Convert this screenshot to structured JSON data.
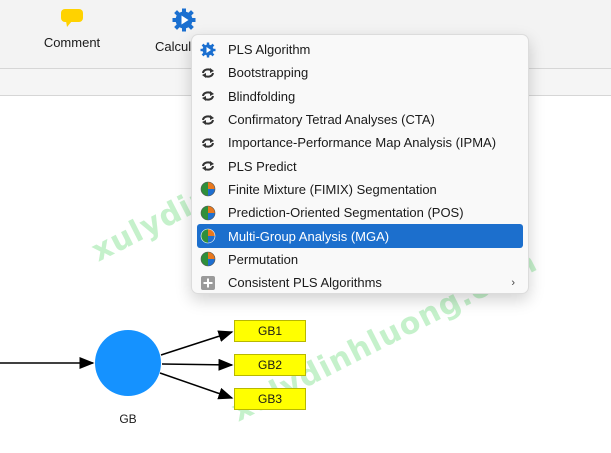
{
  "toolbar": {
    "comment_label": "Comment",
    "calculate_label": "Calcul"
  },
  "menu": {
    "items": [
      {
        "label": "PLS Algorithm",
        "icon": "gear-play-icon"
      },
      {
        "label": "Bootstrapping",
        "icon": "cycle-arrows-icon"
      },
      {
        "label": "Blindfolding",
        "icon": "cycle-arrows-icon"
      },
      {
        "label": "Confirmatory Tetrad Analyses (CTA)",
        "icon": "cycle-arrows-icon"
      },
      {
        "label": "Importance-Performance Map Analysis (IPMA)",
        "icon": "cycle-arrows-icon"
      },
      {
        "label": "PLS Predict",
        "icon": "cycle-arrows-icon"
      },
      {
        "label": "Finite Mixture (FIMIX) Segmentation",
        "icon": "segmentation-globe-icon"
      },
      {
        "label": "Prediction-Oriented Segmentation (POS)",
        "icon": "segmentation-globe-icon"
      },
      {
        "label": "Multi-Group Analysis (MGA)",
        "icon": "segmentation-globe-icon"
      },
      {
        "label": "Permutation",
        "icon": "segmentation-globe-icon"
      },
      {
        "label": "Consistent PLS Algorithms",
        "icon": "plus-box-icon",
        "submenu_arrow": "›"
      }
    ],
    "selected_index": 8
  },
  "diagram": {
    "node_label": "GB",
    "boxes": [
      "GB1",
      "GB2",
      "GB3"
    ]
  },
  "watermark": {
    "text1": "xulydinhluong.com",
    "text2": "xulydinhluong.com"
  },
  "colors": {
    "accent": "#1c6fcd",
    "node_fill": "#1592ff",
    "box_fill": "#ffff00",
    "comment_icon": "#ffd200",
    "calc_icon": "#1a6fd0"
  }
}
